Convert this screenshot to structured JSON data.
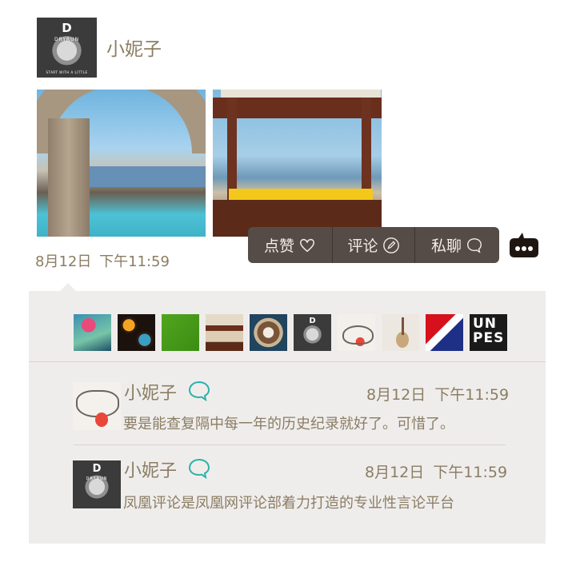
{
  "post": {
    "author": "小妮子",
    "avatar_logo": "D",
    "avatar_brand": "DRYRUN",
    "avatar_tagline": "START WITH A LITTLE",
    "time": "8月12日 下午11:59",
    "photos": [
      "pool-terrace-photo",
      "cabana-photo"
    ]
  },
  "actions": {
    "like_label": "点赞",
    "comment_label": "评论",
    "dm_label": "私聊",
    "icons": {
      "like": "heart-icon",
      "comment": "pencil-icon",
      "dm": "chat-bubble-icon",
      "more": "more-bubble-icon"
    }
  },
  "likers": {
    "count": 10,
    "avatar_texts": {
      "dryrun": "D",
      "poster": "UN PES"
    }
  },
  "comments": [
    {
      "author": "小妮子",
      "time": "8月12日 下午11:59",
      "text": "要是能查复隔中每一年的历史纪录就好了。可惜了。",
      "avatar": "cat-drawing"
    },
    {
      "author": "小妮子",
      "time": "8月12日 下午11:59",
      "text": "凤凰评论是凤凰网评论部着力打造的专业性言论平台",
      "avatar": "dryrun-head",
      "avatar_logo": "D",
      "avatar_brand": "DRYRUN"
    }
  ],
  "colors": {
    "text": "#8b7d63",
    "menu_bg": "#554c47",
    "panel_bg": "#efedec",
    "comment_icon": "#2bb3a8"
  }
}
